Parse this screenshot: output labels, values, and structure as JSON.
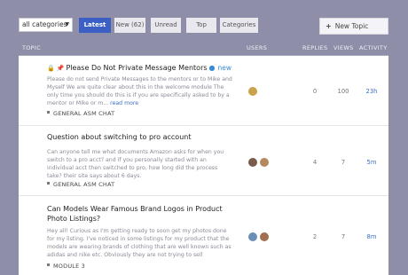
{
  "toolbar": {
    "category_select": "all categories",
    "nav": [
      "Latest",
      "New (62)",
      "Unread",
      "Top",
      "Categories"
    ],
    "new_topic": "New Topic"
  },
  "columns": {
    "topic": "TOPIC",
    "users": "USERS",
    "replies": "REPLIES",
    "views": "VIEWS",
    "activity": "ACTIVITY"
  },
  "topics": [
    {
      "title": "Please Do Not Private Message Mentors",
      "badge": "new",
      "excerpt": "Please do not send Private Messages to the mentors or to Mike and Myself We are quite clear about this in the welcome module The only time you should do this is if you are specifically asked to by a mentor or Mike or m...",
      "read_more": "read more",
      "category": "GENERAL ASM CHAT",
      "replies": "0",
      "views": "100",
      "activity": "23h",
      "avatar_colors": [
        "#c9a24a"
      ]
    },
    {
      "title": "Question about switching to pro account",
      "badge": "",
      "excerpt": "Can anyone tell me what documents Amazon asks for when you switch to a pro acct? and if you personally started with an individual acct then switched to pro, how long did the process take? their site says about 6 days.",
      "read_more": "",
      "category": "GENERAL ASM CHAT",
      "replies": "4",
      "views": "7",
      "activity": "5m",
      "avatar_colors": [
        "#7a5a48",
        "#b58a5e"
      ]
    },
    {
      "title": "Can Models Wear Famous Brand Logos in Product Photo Listings?",
      "badge": "",
      "excerpt": "Hey all! Curious as I'm getting ready to soon get my photos done for my listing. I've noticed in some listings for my product that the models are wearing brands of clothing that are well known such as adidas and nike etc. Obviously they are not trying to sell",
      "read_more": "",
      "category": "MODULE 3",
      "replies": "2",
      "views": "7",
      "activity": "8m",
      "avatar_colors": [
        "#6a8fb8",
        "#a07050"
      ]
    }
  ]
}
